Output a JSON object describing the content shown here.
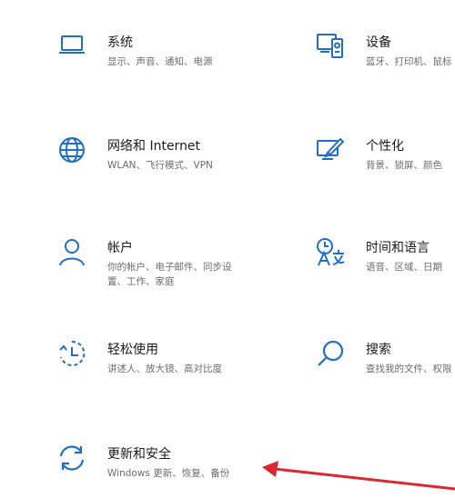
{
  "colors": {
    "accent": "#1f6fc9",
    "annotation_arrow": "#d9282f",
    "title_text": "#1a1a1a",
    "description_text": "#6b6b6b"
  },
  "tiles": {
    "system": {
      "title": "系统",
      "desc": "显示、声音、通知、电源",
      "icon": "monitor-icon"
    },
    "devices": {
      "title": "设备",
      "desc": "蓝牙、打印机、鼠标",
      "icon": "devices-icon"
    },
    "network": {
      "title": "网络和 Internet",
      "desc": "WLAN、飞行模式、VPN",
      "icon": "globe-icon"
    },
    "personal": {
      "title": "个性化",
      "desc": "背景、锁屏、颜色",
      "icon": "personalization-icon"
    },
    "accounts": {
      "title": "帐户",
      "desc": "你的帐户、电子邮件、同步设置、工作、家庭",
      "desc_line1": "你的帐户、电子邮件、同步设",
      "desc_line2": "置、工作、家庭",
      "icon": "person-icon"
    },
    "time": {
      "title": "时间和语言",
      "desc": "语音、区域、日期",
      "icon": "time-language-icon"
    },
    "ease": {
      "title": "轻松使用",
      "desc": "讲述人、放大镜、高对比度",
      "icon": "ease-of-access-icon"
    },
    "search": {
      "title": "搜索",
      "desc": "查找我的文件、权限",
      "icon": "search-icon"
    },
    "update": {
      "title": "更新和安全",
      "desc": "Windows 更新、恢复、备份",
      "icon": "sync-icon"
    }
  }
}
